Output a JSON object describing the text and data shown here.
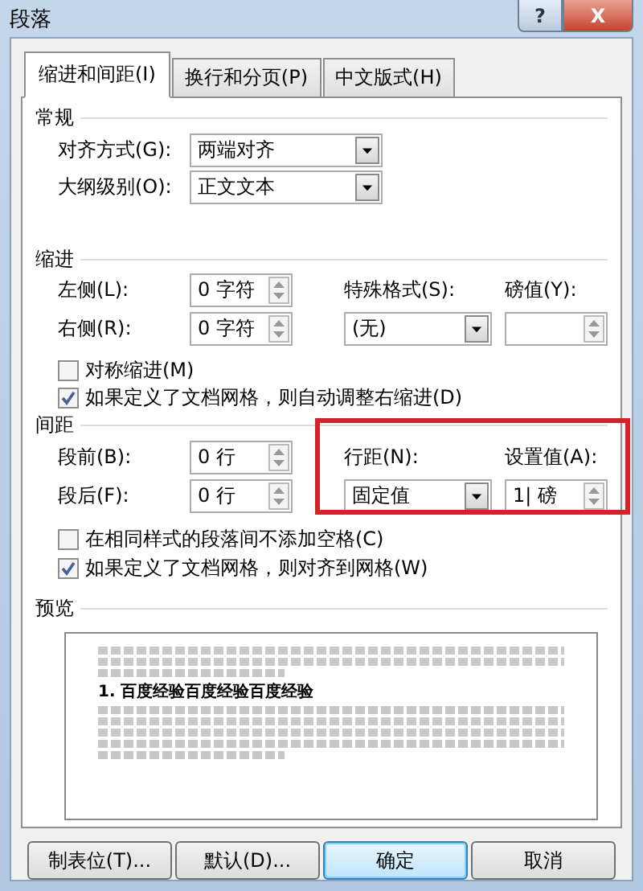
{
  "window": {
    "title": "段落",
    "help": "?",
    "close": "X"
  },
  "tabs": [
    {
      "label": "缩进和间距(I)",
      "selected": true
    },
    {
      "label": "换行和分页(P)",
      "selected": false
    },
    {
      "label": "中文版式(H)",
      "selected": false
    }
  ],
  "general": {
    "heading": "常规",
    "fields": [
      {
        "label": "对齐方式(G):",
        "value": "两端对齐"
      },
      {
        "label": "大纲级别(O):",
        "value": "正文文本"
      }
    ]
  },
  "indent": {
    "heading": "缩进",
    "left": {
      "label": "左侧(L):",
      "value": "0 字符"
    },
    "right": {
      "label": "右侧(R):",
      "value": "0 字符"
    },
    "special": {
      "label": "特殊格式(S):",
      "value": "(无)"
    },
    "amount": {
      "label": "磅值(Y):"
    },
    "checkboxes": [
      {
        "label": "对称缩进(M)",
        "checked": false
      },
      {
        "label": "如果定义了文档网格，则自动调整右缩进(D)",
        "checked": true
      }
    ]
  },
  "spacing": {
    "heading": "间距",
    "before": {
      "label": "段前(B):",
      "value": "0 行"
    },
    "after": {
      "label": "段后(F):",
      "value": "0 行"
    },
    "line_spacing": {
      "label": "行距(N):",
      "value": "固定值"
    },
    "at": {
      "label": "设置值(A):",
      "value": "1| 磅"
    },
    "highlighted": true,
    "checkboxes": [
      {
        "label": "在相同样式的段落间不添加空格(C)",
        "checked": false
      },
      {
        "label": "如果定义了文档网格，则对齐到网格(W)",
        "checked": true
      }
    ]
  },
  "preview": {
    "heading": "预览",
    "sample": "1. 百度经验百度经验百度经验"
  },
  "buttons": [
    {
      "label": "制表位(T)...",
      "default": false
    },
    {
      "label": "默认(D)...",
      "default": false
    },
    {
      "label": "确定",
      "default": true
    },
    {
      "label": "取消",
      "default": false
    }
  ]
}
